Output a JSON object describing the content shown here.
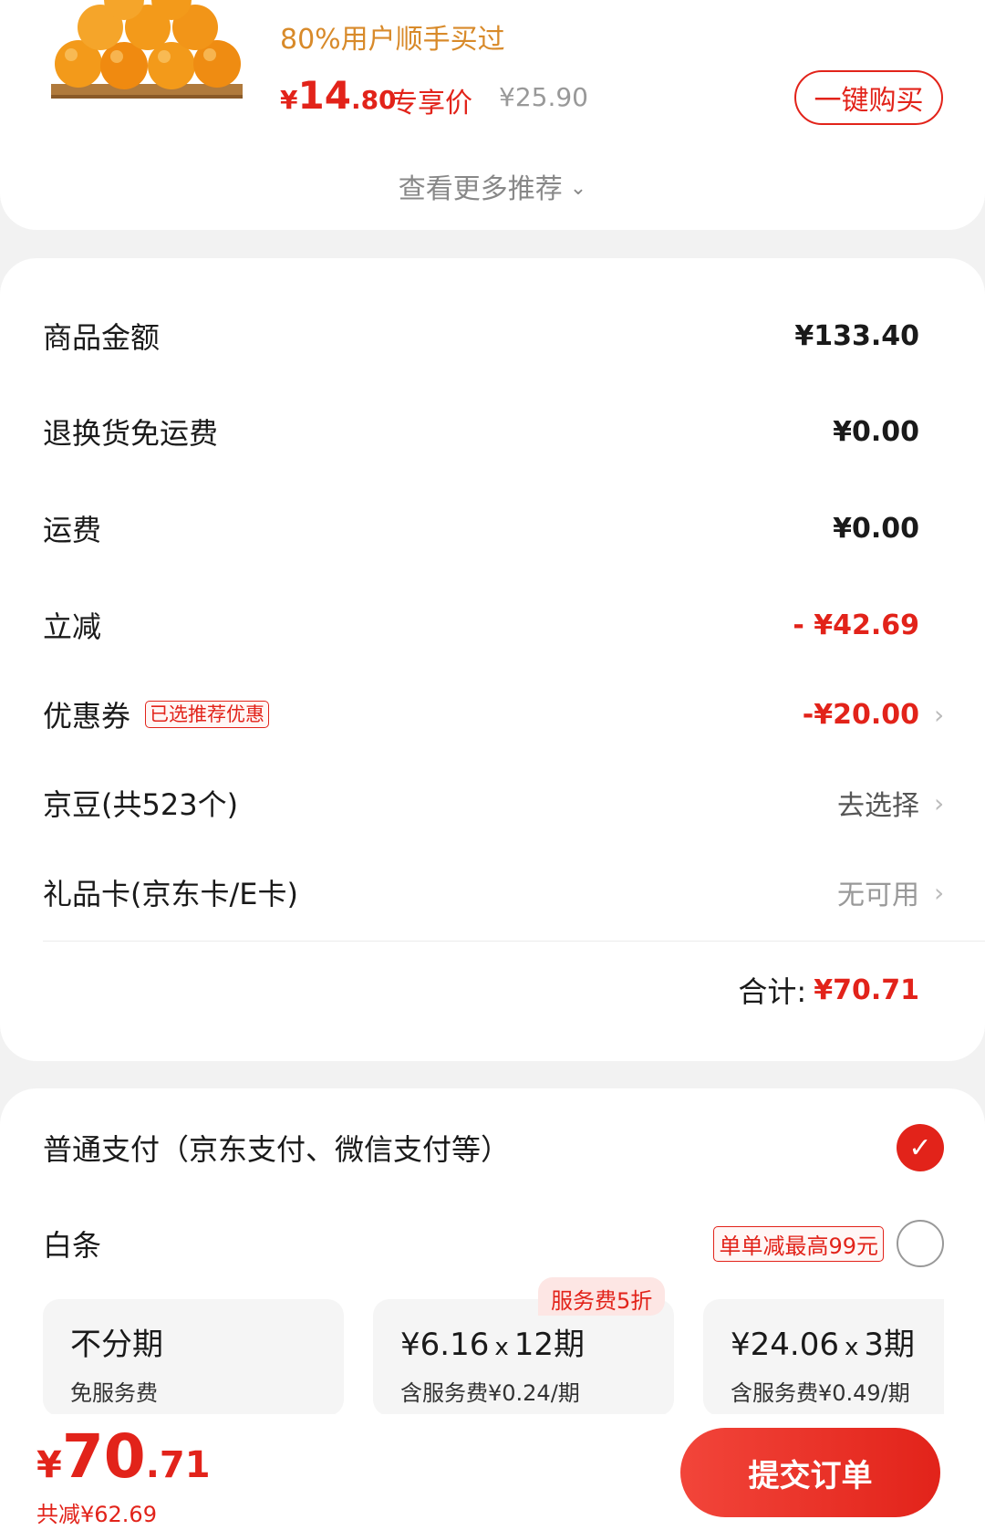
{
  "recommend": {
    "tag": "80%用户顺手买过",
    "price_symbol": "¥",
    "price_int": "14",
    "price_dec": ".80",
    "exclusive_label": "专享价",
    "original_price": "¥25.90",
    "buy_button": "一键购买",
    "more_label": "查看更多推荐",
    "more_icon": "chevron-down-icon"
  },
  "summary": {
    "rows": [
      {
        "label": "商品金额",
        "value": "¥133.40"
      },
      {
        "label": "退换货免运费",
        "value": "¥0.00"
      },
      {
        "label": "运费",
        "value": "¥0.00"
      },
      {
        "label": "立减",
        "value": "- ¥42.69"
      },
      {
        "label": "优惠券",
        "tag": "已选推荐优惠",
        "value": "-¥20.00"
      },
      {
        "label": "京豆(共523个)",
        "value": "去选择"
      },
      {
        "label": "礼品卡(京东卡/E卡)",
        "value": "无可用"
      }
    ],
    "total_label": "合计:",
    "total_value": "¥70.71"
  },
  "payment": {
    "normal_label": "普通支付（京东支付、微信支付等）",
    "normal_selected": true,
    "baitiao_label": "白条",
    "baitiao_tag": "单单减最高99元",
    "baitiao_selected": false,
    "plans": [
      {
        "title": "不分期",
        "amount": "",
        "periods": "",
        "subtitle": "免服务费"
      },
      {
        "title": "",
        "amount": "¥6.16",
        "periods": "12期",
        "subtitle": "含服务费¥0.24/期"
      },
      {
        "title": "",
        "amount": "¥24.06",
        "periods": "3期",
        "subtitle": "含服务费¥0.49/期"
      }
    ],
    "plan_badge": "服务费5折"
  },
  "bottom": {
    "total_symbol": "¥",
    "total_int": "70",
    "total_dec": ".71",
    "saved": "共减¥62.69",
    "submit": "提交订单"
  },
  "colors": {
    "accent": "#e2231a",
    "tag_orange": "#d88a2a",
    "background": "#f2f2f2"
  }
}
